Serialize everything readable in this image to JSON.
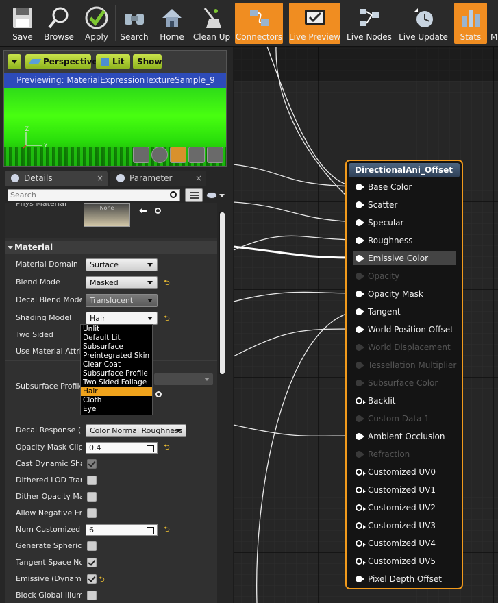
{
  "toolbar": [
    {
      "label": "Save",
      "icon": "save-icon",
      "active": false
    },
    {
      "label": "Browse",
      "icon": "browse-icon",
      "active": false
    },
    {
      "label": "Apply",
      "icon": "apply-icon",
      "active": false
    },
    {
      "label": "Search",
      "icon": "search-icon",
      "active": false
    },
    {
      "label": "Home",
      "icon": "home-icon",
      "active": false
    },
    {
      "label": "Clean Up",
      "icon": "clean-up-icon",
      "active": false
    },
    {
      "label": "Connectors",
      "icon": "connectors-icon",
      "active": true
    },
    {
      "label": "Live Preview",
      "icon": "live-preview-icon",
      "active": true
    },
    {
      "label": "Live Nodes",
      "icon": "live-nodes-icon",
      "active": false
    },
    {
      "label": "Live Update",
      "icon": "live-update-icon",
      "active": false
    },
    {
      "label": "Stats",
      "icon": "stats-icon",
      "active": true
    },
    {
      "label": "M",
      "icon": "more-icon",
      "active": false
    }
  ],
  "viewport": {
    "perspective": "Perspective",
    "lit": "Lit",
    "show": "Show",
    "previewing": "Previewing: MaterialExpressionTextureSample_9",
    "axis_z": "Z",
    "axis_y": "Y"
  },
  "tabs": {
    "details": "Details",
    "parameter_defaults": "Parameter Defaults"
  },
  "search_placeholder": "Search",
  "phys_material": {
    "label": "Phys Material",
    "thumb": "None"
  },
  "section_material": "Material",
  "props": {
    "material_domain": {
      "label": "Material Domain",
      "value": "Surface"
    },
    "blend_mode": {
      "label": "Blend Mode",
      "value": "Masked"
    },
    "decal_blend_mode": {
      "label": "Decal Blend Mode",
      "value": "Translucent"
    },
    "shading_model": {
      "label": "Shading Model",
      "value": "Hair"
    },
    "two_sided": {
      "label": "Two Sided"
    },
    "use_material_attributes": {
      "label": "Use Material Attributes"
    },
    "subsurface_profile": {
      "label": "Subsurface Profile"
    },
    "decal_response": {
      "label": "Decal Response (DBuffer)",
      "value": "Color Normal Roughness"
    },
    "opacity_mask_clip": {
      "label": "Opacity Mask Clip Value",
      "value": "0.4"
    },
    "cast_dynamic_shadow": {
      "label": "Cast Dynamic Shadow as Masked",
      "checked": true
    },
    "dithered_lod": {
      "label": "Dithered LOD Transition",
      "checked": false
    },
    "dither_opacity": {
      "label": "Dither Opacity Mask",
      "checked": false
    },
    "allow_negative": {
      "label": "Allow Negative Emissive Color",
      "checked": false
    },
    "num_customized_uvs": {
      "label": "Num Customized UVs",
      "value": "6"
    },
    "generate_spherical": {
      "label": "Generate Spherical Particle Normals",
      "checked": false
    },
    "tangent_space_normal": {
      "label": "Tangent Space Normal",
      "checked": true
    },
    "emissive_dynamic": {
      "label": "Emissive (Dynamic Area Light)",
      "checked": true
    },
    "block_gi": {
      "label": "Block Global Illumination",
      "checked": false
    }
  },
  "shading_options": [
    "Unlit",
    "Default Lit",
    "Subsurface",
    "Preintegrated Skin",
    "Clear Coat",
    "Subsurface Profile",
    "Two Sided Foliage",
    "Hair",
    "Cloth",
    "Eye"
  ],
  "shading_selected": "Hair",
  "node": {
    "title": "DirectionalAni_Offset",
    "pins": [
      {
        "label": "Base Color",
        "state": "on"
      },
      {
        "label": "Scatter",
        "state": "on"
      },
      {
        "label": "Specular",
        "state": "on"
      },
      {
        "label": "Roughness",
        "state": "on"
      },
      {
        "label": "Emissive Color",
        "state": "hl"
      },
      {
        "label": "Opacity",
        "state": "dis"
      },
      {
        "label": "Opacity Mask",
        "state": "on"
      },
      {
        "label": "Tangent",
        "state": "on"
      },
      {
        "label": "World Position Offset",
        "state": "on"
      },
      {
        "label": "World Displacement",
        "state": "dis"
      },
      {
        "label": "Tessellation Multiplier",
        "state": "dis"
      },
      {
        "label": "Subsurface Color",
        "state": "dis"
      },
      {
        "label": "Backlit",
        "state": "hollow"
      },
      {
        "label": "Custom Data 1",
        "state": "dis"
      },
      {
        "label": "Ambient Occlusion",
        "state": "on"
      },
      {
        "label": "Refraction",
        "state": "dis"
      },
      {
        "label": "Customized UV0",
        "state": "hollow"
      },
      {
        "label": "Customized UV1",
        "state": "hollow"
      },
      {
        "label": "Customized UV2",
        "state": "hollow"
      },
      {
        "label": "Customized UV3",
        "state": "hollow"
      },
      {
        "label": "Customized UV4",
        "state": "hollow"
      },
      {
        "label": "Customized UV5",
        "state": "hollow"
      },
      {
        "label": "Pixel Depth Offset",
        "state": "on"
      }
    ]
  },
  "colors": {
    "accent": "#f08d21",
    "node_border": "#f19a1c",
    "preview_bar": "#2d4bb9"
  }
}
